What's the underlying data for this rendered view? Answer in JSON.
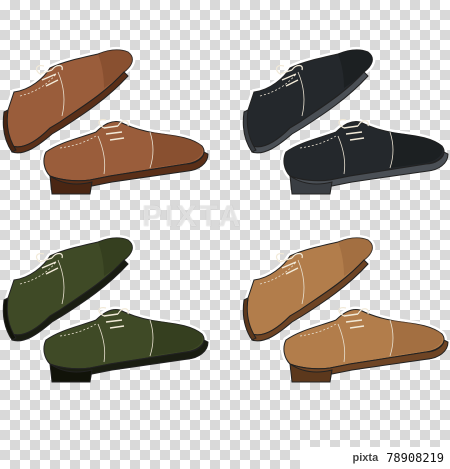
{
  "watermark": {
    "brand": "PIXTA",
    "sub": ""
  },
  "stock_id": {
    "brand": "pixta",
    "number": "78908219"
  },
  "pairs": [
    {
      "name": "brown",
      "upper": "#9a5d3b",
      "upper_shade": "#7c4528",
      "sole": "#5a2f18",
      "heel": "#4a2613"
    },
    {
      "name": "black",
      "upper": "#24282c",
      "upper_shade": "#16191c",
      "sole": "#4a4f55",
      "heel": "#3a3e43"
    },
    {
      "name": "olive",
      "upper": "#3f4a26",
      "upper_shade": "#2d3619",
      "sole": "#1a1d12",
      "heel": "#111309"
    },
    {
      "name": "tan",
      "upper": "#b27d4b",
      "upper_shade": "#97643a",
      "sole": "#6e4424",
      "heel": "#5c381c"
    }
  ]
}
